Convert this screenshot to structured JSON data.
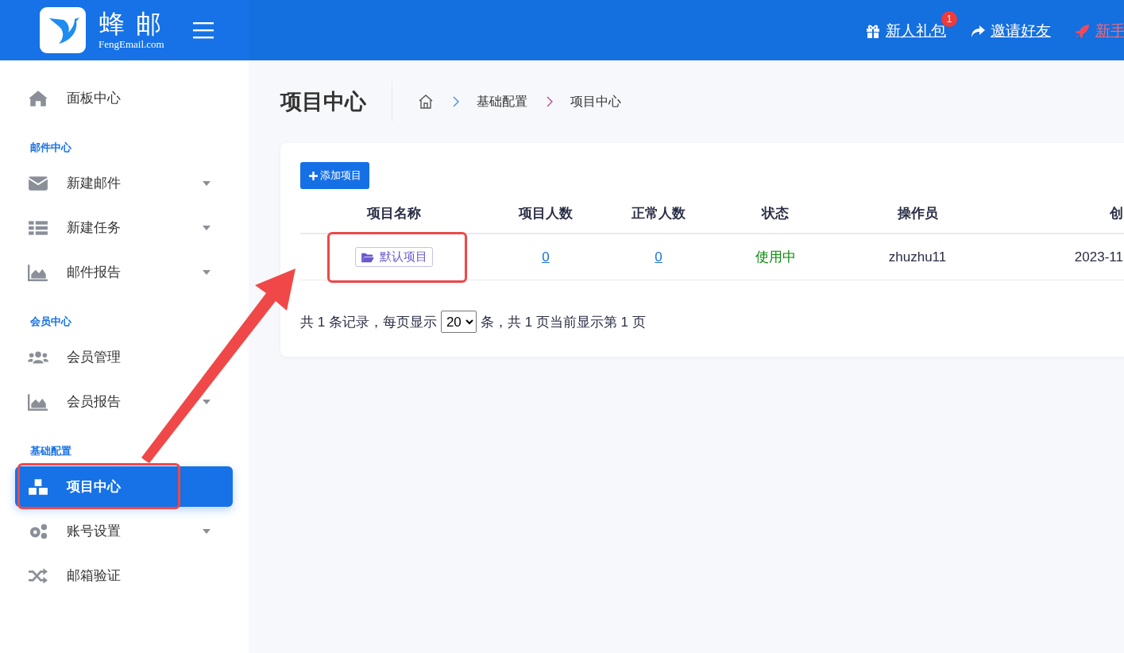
{
  "brand": {
    "name": "蜂 邮",
    "domain": "FengEmail.com"
  },
  "header_links": [
    {
      "label": "新人礼包",
      "badge": "1",
      "kind": "gift"
    },
    {
      "label": " 邀请好友",
      "kind": "share"
    },
    {
      "label": "新手",
      "kind": "rocket"
    }
  ],
  "sidebar": [
    {
      "kind": "item",
      "label": "面板中心",
      "expandable": false,
      "selected": false,
      "highlighted": false
    },
    {
      "kind": "section",
      "label": "邮件中心"
    },
    {
      "kind": "item",
      "label": "新建邮件",
      "expandable": true,
      "selected": false,
      "highlighted": false
    },
    {
      "kind": "item",
      "label": "新建任务",
      "expandable": true,
      "selected": false,
      "highlighted": false
    },
    {
      "kind": "item",
      "label": "邮件报告",
      "expandable": true,
      "selected": false,
      "highlighted": false
    },
    {
      "kind": "section",
      "label": "会员中心"
    },
    {
      "kind": "item",
      "label": "会员管理",
      "expandable": false,
      "selected": false,
      "highlighted": false
    },
    {
      "kind": "item",
      "label": "会员报告",
      "expandable": true,
      "selected": false,
      "highlighted": false
    },
    {
      "kind": "section",
      "label": "基础配置"
    },
    {
      "kind": "item",
      "label": "项目中心",
      "expandable": false,
      "selected": true,
      "highlighted": true
    },
    {
      "kind": "item",
      "label": "账号设置",
      "expandable": true,
      "selected": false,
      "highlighted": false
    },
    {
      "kind": "item",
      "label": "邮箱验证",
      "expandable": false,
      "selected": false,
      "highlighted": false
    }
  ],
  "page_title": "项目中心",
  "breadcrumb": [
    "基础配置",
    "项目中心"
  ],
  "add_button": "添加项目",
  "table": {
    "columns": [
      "项目名称",
      "项目人数",
      "正常人数",
      "状态",
      "操作员",
      "创"
    ],
    "rows": [
      {
        "name": "默认项目",
        "name_highlighted": true,
        "members": "0",
        "normal": "0",
        "status": "使用中",
        "active": true,
        "operator": "zhuzhu11",
        "created": "2023-11"
      }
    ]
  },
  "pagination": {
    "before": "共 1 条记录，每页显示",
    "page_size": "20",
    "after": "条，共 1 页当前显示第 1 页"
  }
}
